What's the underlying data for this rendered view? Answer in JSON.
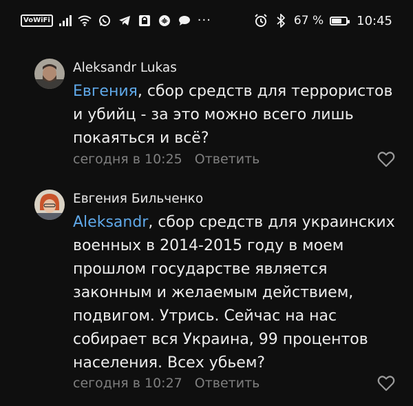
{
  "status_bar": {
    "wifi_label": "VoWiFi",
    "battery_percent_text": "67 %",
    "battery_level": 0.67,
    "time": "10:45",
    "more_text": "···",
    "icons": [
      "signal-icon",
      "wifi-icon",
      "whatsapp-icon",
      "telegram-icon",
      "lock-app-icon",
      "audio-app-icon",
      "chat-bubble-icon",
      "alarm-icon",
      "bluetooth-icon",
      "battery-icon"
    ]
  },
  "comments": [
    {
      "author": "Aleksandr Lukas",
      "mention": "Евгения",
      "line1_rest": ", сбор средств для террористов",
      "lines": [
        "и убийц - за это можно всего лишь",
        "покаяться и всё?"
      ],
      "time": "сегодня в 10:25",
      "reply_label": "Ответить"
    },
    {
      "author": "Евгения Бильченко",
      "mention": "Aleksandr",
      "line1_rest": ", сбор средств для украинских",
      "lines": [
        "военных в 2014-2015 году в моем",
        "прошлом государстве является",
        "законным и желаемым действием,",
        "подвигом. Утрись. Сейчас на нас",
        "собирает вся Украина, 99 процентов",
        "населения. Всех убьем?"
      ],
      "time": "сегодня в 10:27",
      "reply_label": "Ответить"
    }
  ],
  "colors": {
    "background": "#0f0f0f",
    "mention": "#5fa8e8",
    "meta": "#7f7f7f",
    "text": "#ececec"
  }
}
